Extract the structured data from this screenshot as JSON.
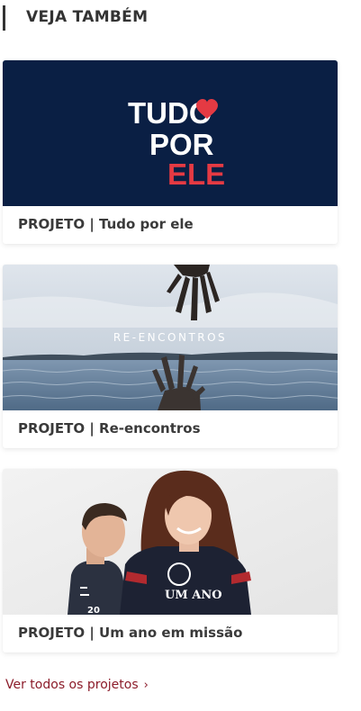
{
  "section": {
    "title": "VEJA TAMBÉM"
  },
  "projects": [
    {
      "title": "PROJETO | Tudo por ele",
      "logo": {
        "line1": "TUDO",
        "line2": "POR",
        "line3": "ELE"
      },
      "colors": {
        "bg": "#0a1f44",
        "accent": "#e53a43",
        "text": "#ffffff"
      }
    },
    {
      "title": "PROJETO | Re-encontros",
      "overlay": "RE-ENCONTROS"
    },
    {
      "title": "PROJETO | Um ano em missão",
      "shirt_text": "UM ANO"
    }
  ],
  "see_all": {
    "label": "Ver todos os projetos",
    "icon": "chevron-right-icon"
  }
}
